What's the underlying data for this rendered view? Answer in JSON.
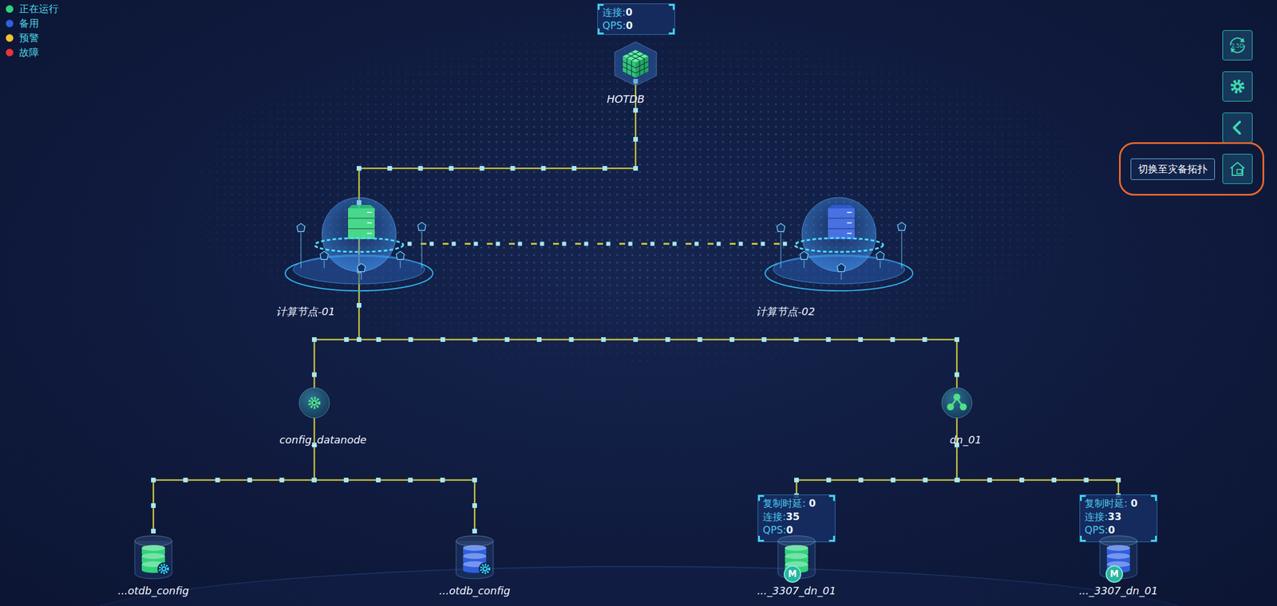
{
  "legend": [
    {
      "key": "running",
      "label": "正在运行",
      "color": "#2fd37a"
    },
    {
      "key": "standby",
      "label": "备用",
      "color": "#2f5fe0"
    },
    {
      "key": "warning",
      "label": "预警",
      "color": "#f0c330"
    },
    {
      "key": "fault",
      "label": "故障",
      "color": "#e8353b"
    }
  ],
  "hotdb": {
    "label": "HOTDB",
    "stats": [
      {
        "label": "连接:",
        "value": "0"
      },
      {
        "label": "QPS:",
        "value": "0"
      }
    ]
  },
  "compute_nodes": [
    {
      "label": "计算节点-01",
      "status": "running"
    },
    {
      "label": "计算节点-02",
      "status": "standby"
    }
  ],
  "groups": [
    {
      "label": "config_datanode",
      "kind": "config",
      "members": [
        {
          "label": "...otdb_config",
          "status": "running"
        },
        {
          "label": "...otdb_config",
          "status": "standby"
        }
      ]
    },
    {
      "label": "dn_01",
      "kind": "datanode",
      "members": [
        {
          "label": "..._3307_dn_01",
          "status": "running",
          "badge": "M",
          "stats": [
            {
              "label": "复制时延: ",
              "value": "0"
            },
            {
              "label": "连接:",
              "value": "35"
            },
            {
              "label": "QPS:",
              "value": "0"
            }
          ]
        },
        {
          "label": "..._3307_dn_01",
          "status": "standby",
          "badge": "M",
          "stats": [
            {
              "label": "复制时延: ",
              "value": "0"
            },
            {
              "label": "连接:",
              "value": "33"
            },
            {
              "label": "QPS:",
              "value": "0"
            }
          ]
        }
      ]
    }
  ],
  "toolbar": [
    {
      "kind": "view-2.5d",
      "text": "2.5D"
    },
    {
      "kind": "settings"
    },
    {
      "kind": "collapse"
    },
    {
      "kind": "switch-topology",
      "tooltip": "切换至灾备拓扑",
      "highlighted": true
    }
  ]
}
